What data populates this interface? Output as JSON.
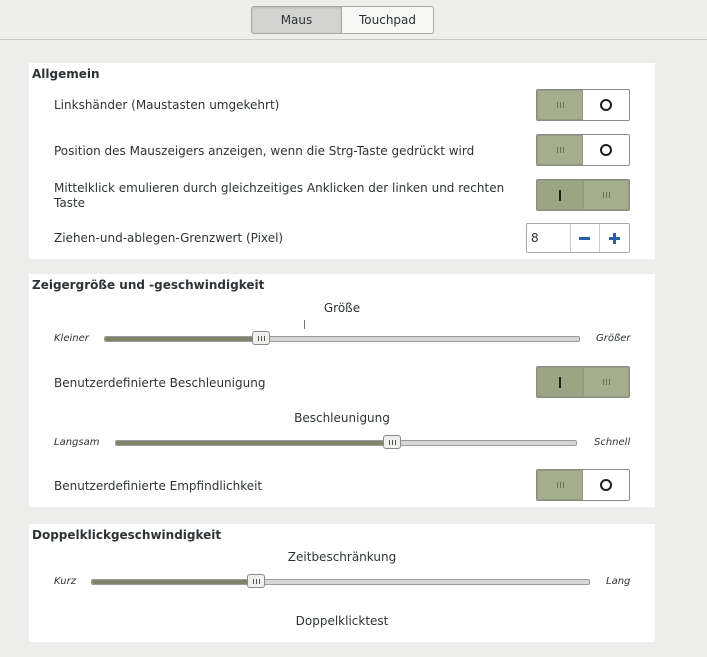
{
  "tabs": [
    {
      "label": "Maus",
      "active": true
    },
    {
      "label": "Touchpad",
      "active": false
    }
  ],
  "general": {
    "title": "Allgemein",
    "left_handed": {
      "label": "Linkshänder (Maustasten umgekehrt)",
      "on": false
    },
    "locate_pointer": {
      "label": "Position des Mauszeigers anzeigen, wenn die Strg-Taste gedrückt wird",
      "on": false
    },
    "middle_click": {
      "label_line1": "Mittelklick emulieren durch gleichzeitiges Anklicken der linken und rechten",
      "label_line2": "Taste",
      "on": true
    },
    "drag_threshold": {
      "label": "Ziehen-und-ablegen-Grenzwert (Pixel)",
      "value": "8"
    }
  },
  "pointer": {
    "title": "Zeigergröße und -geschwindigkeit",
    "size": {
      "title": "Größe",
      "min_label": "Kleiner",
      "max_label": "Größer",
      "value_fraction": 0.33
    },
    "custom_accel": {
      "label": "Benutzerdefinierte Beschleunigung",
      "on": true
    },
    "acceleration": {
      "title": "Beschleunigung",
      "min_label": "Langsam",
      "max_label": "Schnell",
      "value_fraction": 0.6
    },
    "custom_sensitivity": {
      "label": "Benutzerdefinierte Empfindlichkeit",
      "on": false
    }
  },
  "double_click": {
    "title": "Doppelklickgeschwindigkeit",
    "timeout": {
      "title": "Zeitbeschränkung",
      "min_label": "Kurz",
      "max_label": "Lang",
      "value_fraction": 0.33
    },
    "test_label": "Doppelklicktest"
  },
  "colors": {
    "switch_on": "#a4ae8d",
    "accent_blue": "#2b5ea8",
    "slider_fill": "#7d8468"
  }
}
